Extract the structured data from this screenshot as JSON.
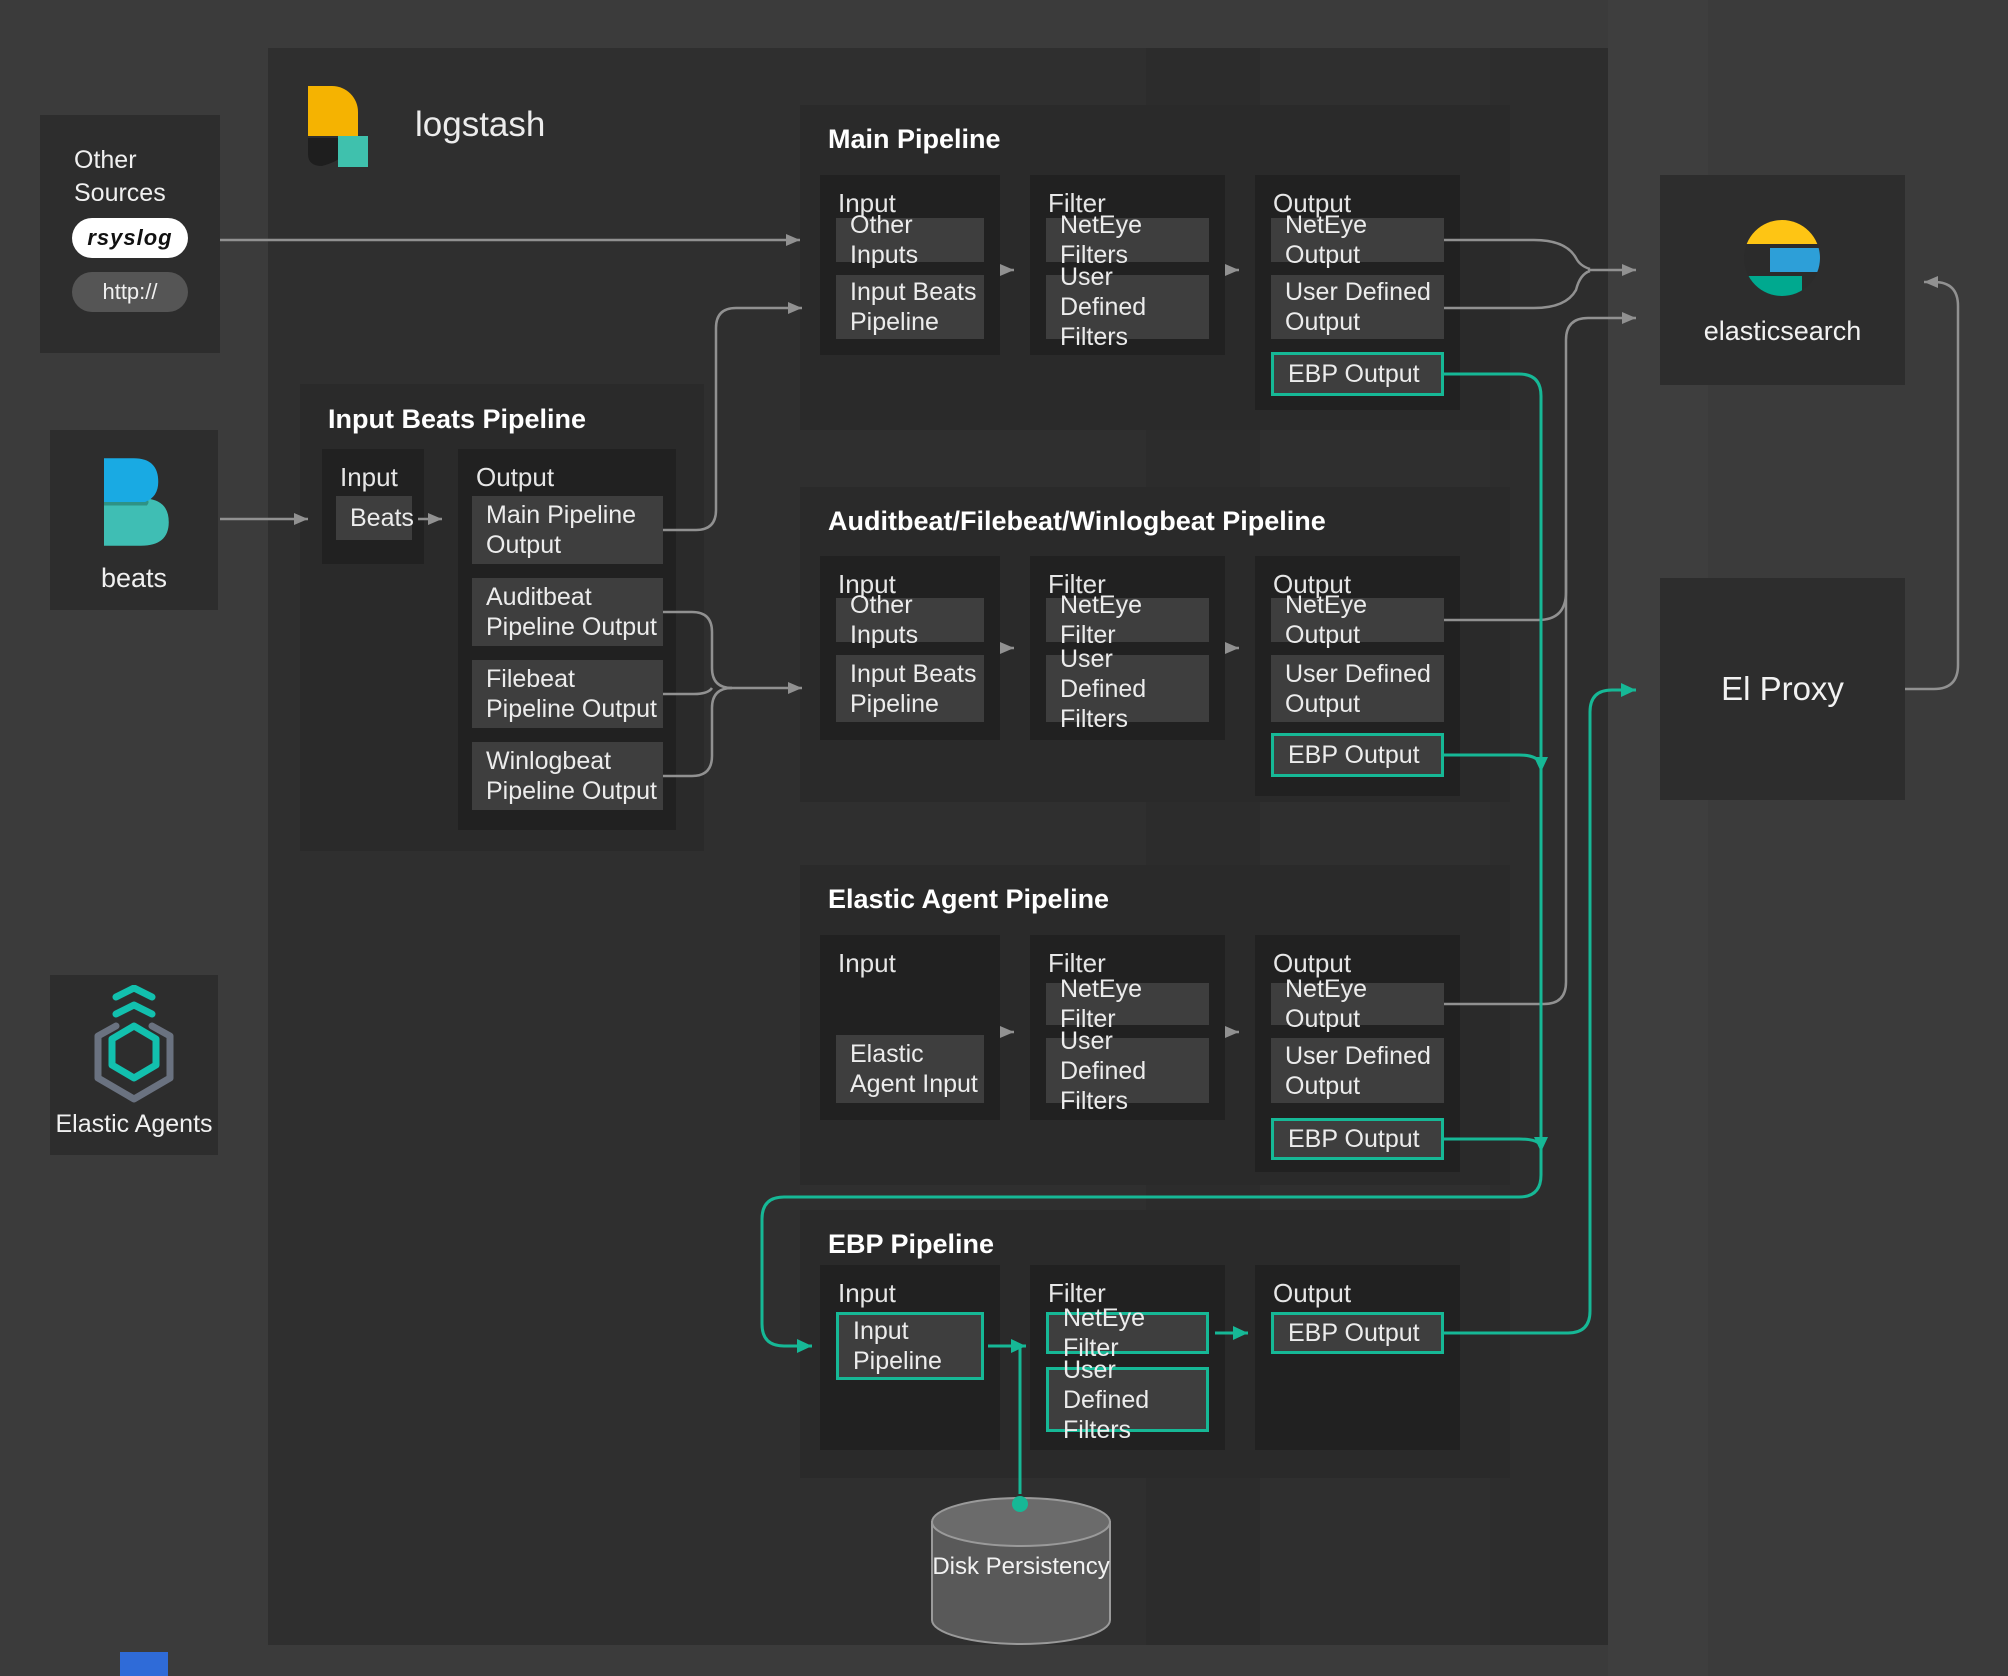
{
  "diagram": {
    "brand": {
      "logstash": "logstash"
    },
    "sources": {
      "other_sources": {
        "title": "Other Sources",
        "rsyslog_label": "rsyslog",
        "http_label": "http://"
      },
      "beats": {
        "label": "beats"
      },
      "elastic_agents": {
        "label": "Elastic Agents"
      }
    },
    "pipelines": {
      "main": {
        "title": "Main Pipeline",
        "input_label": "Input",
        "filter_label": "Filter",
        "output_label": "Output",
        "inputs": [
          "Other Inputs",
          "Input Beats Pipeline"
        ],
        "filters": [
          "NetEye Filters",
          "User Defined Filters"
        ],
        "outputs": [
          "NetEye Output",
          "User Defined Output",
          "EBP Output"
        ]
      },
      "input_beats": {
        "title": "Input Beats Pipeline",
        "input_label": "Input",
        "output_label": "Output",
        "inputs": [
          "Beats"
        ],
        "outputs": [
          "Main Pipeline Output",
          "Auditbeat Pipeline Output",
          "Filebeat Pipeline Output",
          "Winlogbeat Pipeline Output"
        ]
      },
      "beats_family": {
        "title": "Auditbeat/Filebeat/Winlogbeat Pipeline",
        "input_label": "Input",
        "filter_label": "Filter",
        "output_label": "Output",
        "inputs": [
          "Other Inputs",
          "Input Beats Pipeline"
        ],
        "filters": [
          "NetEye Filter",
          "User Defined Filters"
        ],
        "outputs": [
          "NetEye Output",
          "User Defined Output",
          "EBP Output"
        ]
      },
      "elastic_agent": {
        "title": "Elastic Agent  Pipeline",
        "input_label": "Input",
        "filter_label": "Filter",
        "output_label": "Output",
        "inputs": [
          "Elastic Agent Input"
        ],
        "filters": [
          "NetEye Filter",
          "User Defined Filters"
        ],
        "outputs": [
          "NetEye Output",
          "User Defined Output",
          "EBP Output"
        ]
      },
      "ebp": {
        "title": "EBP Pipeline",
        "input_label": "Input",
        "filter_label": "Filter",
        "output_label": "Output",
        "inputs": [
          "Input Pipeline"
        ],
        "filters": [
          "NetEye Filter",
          "User Defined Filters"
        ],
        "outputs": [
          "EBP Output"
        ]
      }
    },
    "destinations": {
      "elasticsearch": {
        "label": "elasticsearch"
      },
      "el_proxy": {
        "label": "El Proxy"
      }
    },
    "storage": {
      "disk_persistency": {
        "label": "Disk Persistency"
      }
    },
    "icons": {
      "logstash": "logstash-logo",
      "beats": "beats-logo",
      "elasticsearch": "elasticsearch-logo",
      "elastic_agents": "elastic-agent-hexagon",
      "rsyslog": "rsyslog-wordmark",
      "disk": "database-cylinder"
    },
    "colors": {
      "accent_teal": "#16b896",
      "line_gray": "#919191",
      "background": "#3b3b3b"
    }
  }
}
